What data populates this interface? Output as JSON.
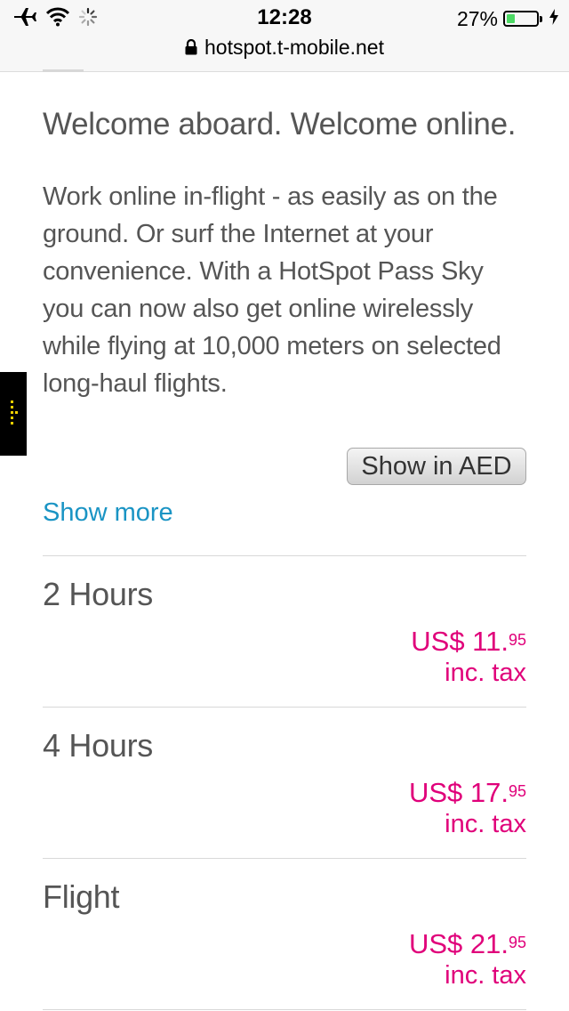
{
  "status_bar": {
    "time": "12:28",
    "battery_percent": "27%",
    "battery_level": 0.27,
    "battery_color": "#4cd964",
    "icons": [
      "airplane-icon",
      "wifi-icon",
      "loading-spinner-icon",
      "battery-icon",
      "charging-bolt-icon"
    ]
  },
  "browser": {
    "url": "hotspot.t-mobile.net",
    "url_icon": "lock-icon"
  },
  "page": {
    "headline": "Welcome aboard. Welcome online.",
    "intro": "Work online in-flight - as easily as on the ground. Or surf the Internet at your convenience. With a HotSpot Pass Sky you can now also get online wirelessly while flying at 10,000 meters on selected long-haul flights.",
    "currency_button": "Show in AED",
    "show_more": "Show more",
    "link_color": "#1a94c4",
    "price_color": "#e0007a",
    "plans": [
      {
        "name": "2 Hours",
        "price_main": "US$ 11.",
        "price_cents": "95",
        "price_note": "inc. tax"
      },
      {
        "name": "4 Hours",
        "price_main": "US$ 17.",
        "price_cents": "95",
        "price_note": "inc. tax"
      },
      {
        "name": "Flight",
        "price_main": "US$ 21.",
        "price_cents": "95",
        "price_note": "inc. tax"
      }
    ]
  }
}
